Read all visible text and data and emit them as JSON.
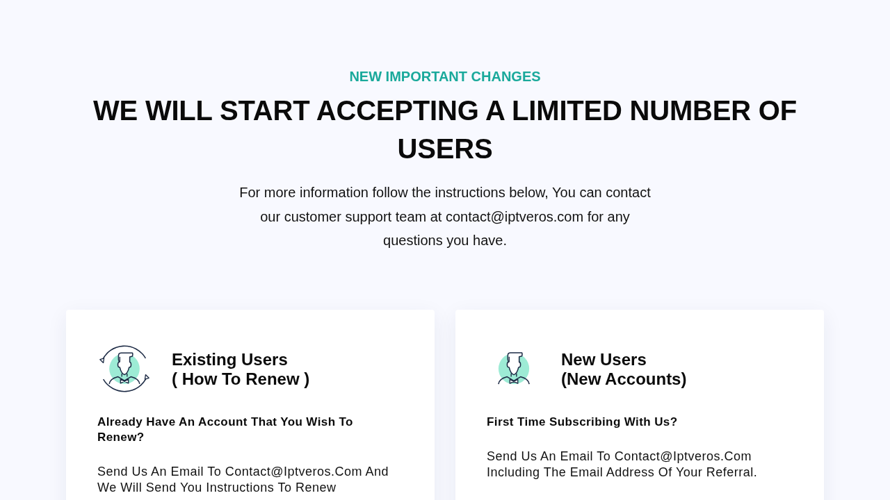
{
  "notice": {
    "eyebrow": "NEW IMPORTANT CHANGES",
    "heading": "WE WILL START ACCEPTING A LIMITED NUMBER OF USERS",
    "intro": "For more information follow the instructions below, You can contact our customer support team at contact@iptveros.com for any questions you have."
  },
  "cards": [
    {
      "kind": "renew",
      "title": "Existing Users",
      "subtitle": "( How To Renew )",
      "question": "Already Have An Account That You Wish To Renew?",
      "body": "Send Us An Email To Contact@Iptveros.Com And We Will Send You Instructions To Renew"
    },
    {
      "kind": "new",
      "title": "New Users",
      "subtitle": "(New Accounts)",
      "question": "First Time Subscribing With Us?",
      "body": "Send Us An Email To Contact@Iptveros.Com Including The Email Address Of Your Referral."
    }
  ]
}
